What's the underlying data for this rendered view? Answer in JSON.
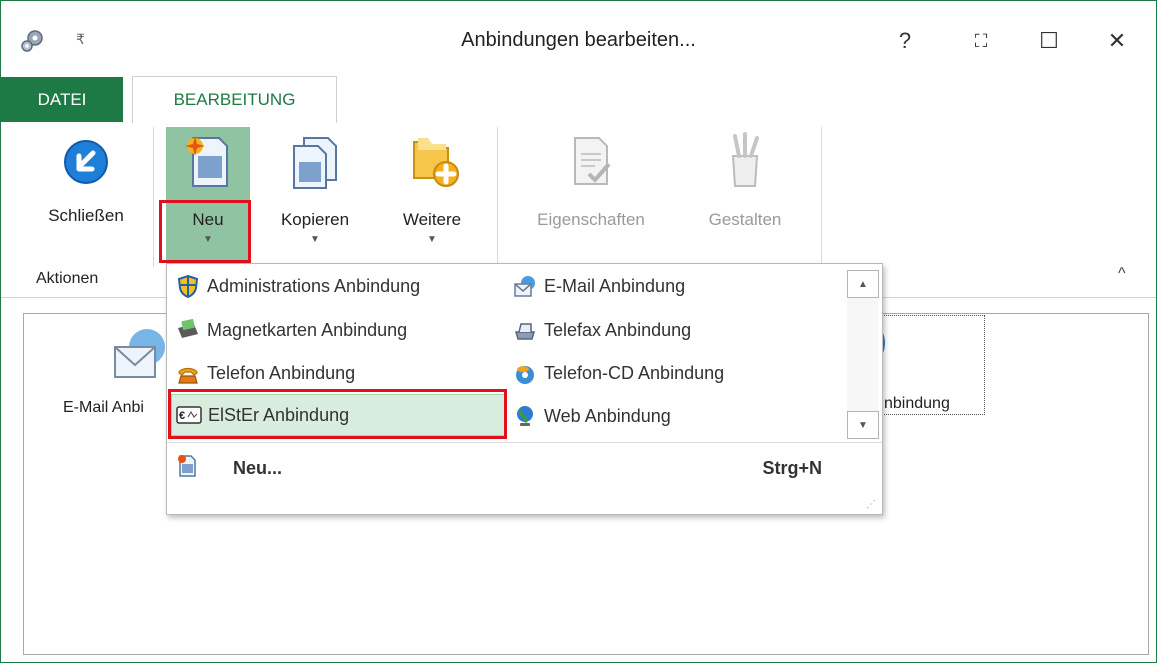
{
  "window": {
    "title": "Anbindungen bearbeiten...",
    "qat_glyph": "₹",
    "help_glyph": "?",
    "fullscreen_glyph": "⛶",
    "maximize_glyph": "☐",
    "close_glyph": "✕"
  },
  "tabs": {
    "datei": "DATEI",
    "bearbeitung": "BEARBEITUNG"
  },
  "ribbon": {
    "schliessen": "Schließen",
    "neu": "Neu",
    "kopieren": "Kopieren",
    "weitere": "Weitere",
    "eigenschaften": "Eigenschaften",
    "gestalten": "Gestalten",
    "group_aktionen": "Aktionen",
    "collapse_glyph": "^"
  },
  "background": {
    "left_item_label": "E-Mail Anbi",
    "right_item_label": "nbindung"
  },
  "dropdown": {
    "items": [
      {
        "label": "Administrations Anbindung",
        "icon": "shield-icon"
      },
      {
        "label": "E-Mail Anbindung",
        "icon": "email-icon"
      },
      {
        "label": "Magnetkarten Anbindung",
        "icon": "card-reader-icon"
      },
      {
        "label": "Telefax Anbindung",
        "icon": "fax-icon"
      },
      {
        "label": "Telefon Anbindung",
        "icon": "phone-icon"
      },
      {
        "label": "Telefon-CD Anbindung",
        "icon": "phone-cd-icon"
      },
      {
        "label": "ElStEr Anbindung",
        "icon": "elster-icon"
      },
      {
        "label": "Web Anbindung",
        "icon": "globe-icon"
      }
    ],
    "new_command": "Neu...",
    "new_shortcut": "Strg+N"
  }
}
